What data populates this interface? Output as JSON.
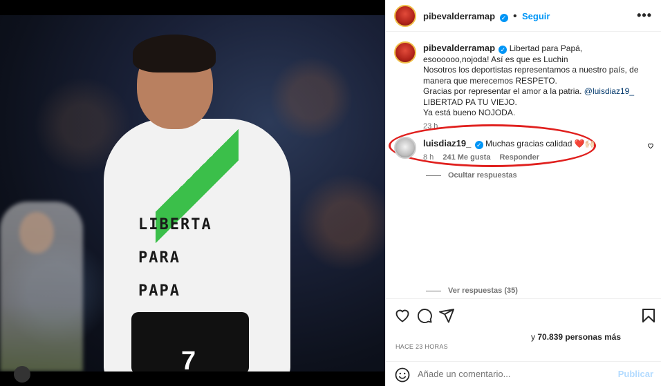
{
  "header": {
    "username": "pibevalderramap",
    "follow_label": "Seguir",
    "more_label": "•••"
  },
  "photo": {
    "shirt_lines": [
      "LIBERTA",
      "PARA",
      "PAPA"
    ],
    "jersey_number": "7"
  },
  "caption": {
    "username": "pibevalderramap",
    "line1": "Libertad para Papá, esoooooo,nojoda! Así es que es Luchin",
    "line2": "Nosotros los deportistas representamos a nuestro país, de manera que merecemos RESPETO.",
    "line3": "Gracias por representar el amor a la patria.",
    "mention": "@luisdiaz19_",
    "line4": "LIBERTAD PA TU VIEJO.",
    "line5": "Ya está bueno NOJODA.",
    "time": "23 h"
  },
  "comment": {
    "username": "luisdiaz19_",
    "text": "Muchas gracias calidad ❤️🙌🏻",
    "time": "8 h",
    "likes": "241 Me gusta",
    "reply_label": "Responder",
    "hide_replies": "Ocultar respuestas",
    "view_replies": "Ver respuestas (35)"
  },
  "actions": {
    "likes_prefix": "y",
    "likes_count": "70.839 personas más",
    "ago": "HACE 23 HORAS"
  },
  "comment_box": {
    "placeholder": "Añade un comentario...",
    "publish_label": "Publicar"
  },
  "colors": {
    "accent": "#0095f6",
    "oval": "#e0201e"
  }
}
